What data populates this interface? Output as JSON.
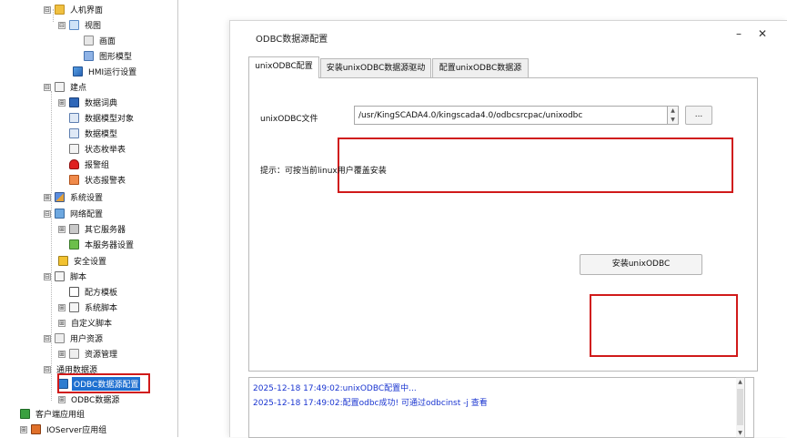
{
  "tree": {
    "items": [
      {
        "label": "人机界面",
        "icon": "folder-icon",
        "toggle": "⊟"
      },
      {
        "label": "视图",
        "icon": "view-icon",
        "toggle": "⊟"
      },
      {
        "label": "画面",
        "icon": "screen-icon",
        "toggle": ""
      },
      {
        "label": "图形模型",
        "icon": "graphic-model-icon",
        "toggle": ""
      },
      {
        "label": "HMI运行设置",
        "icon": "hmi-run-icon",
        "toggle": ""
      },
      {
        "label": "建点",
        "icon": "list-icon",
        "toggle": "⊟"
      },
      {
        "label": "数据词典",
        "icon": "book-icon",
        "toggle": "⊞"
      },
      {
        "label": "数据模型对象",
        "icon": "grid-icon",
        "toggle": ""
      },
      {
        "label": "数据模型",
        "icon": "grid-icon",
        "toggle": ""
      },
      {
        "label": "状态枚举表",
        "icon": "list-icon",
        "toggle": ""
      },
      {
        "label": "报警组",
        "icon": "alarm-icon",
        "toggle": ""
      },
      {
        "label": "状态报警表",
        "icon": "alarm-table-icon",
        "toggle": ""
      },
      {
        "label": "系统设置",
        "icon": "system-settings-icon",
        "toggle": "⊞"
      },
      {
        "label": "网络配置",
        "icon": "network-icon",
        "toggle": "⊟"
      },
      {
        "label": "其它服务器",
        "icon": "server-icon",
        "toggle": "⊞"
      },
      {
        "label": "本服务器设置",
        "icon": "local-server-icon",
        "toggle": ""
      },
      {
        "label": "安全设置",
        "icon": "lock-icon",
        "toggle": ""
      },
      {
        "label": "脚本",
        "icon": "script-icon",
        "toggle": "⊟"
      },
      {
        "label": "配方模板",
        "icon": "recipe-icon",
        "toggle": ""
      },
      {
        "label": "系统脚本",
        "icon": "script-icon",
        "toggle": "⊞"
      },
      {
        "label": "自定义脚本",
        "icon": "",
        "toggle": "⊞"
      },
      {
        "label": "用户资源",
        "icon": "resource-icon",
        "toggle": "⊟"
      },
      {
        "label": "资源管理",
        "icon": "resource-icon",
        "toggle": "⊞"
      },
      {
        "label": "通用数据源",
        "icon": "",
        "toggle": "⊟"
      },
      {
        "label": "ODBC数据源配置",
        "icon": "odbc-config-icon",
        "toggle": ""
      },
      {
        "label": "ODBC数据源",
        "icon": "odbc-source-icon",
        "toggle": "⊞"
      },
      {
        "label": "客户端应用组",
        "icon": "client-group-icon",
        "toggle": ""
      },
      {
        "label": "IOServer应用组",
        "icon": "ioserver-group-icon",
        "toggle": "⊞"
      }
    ]
  },
  "dialog": {
    "title": "ODBC数据源配置",
    "minimize_glyph": "–",
    "close_glyph": "✕",
    "tabs": [
      {
        "label": "unixODBC配置",
        "active": true
      },
      {
        "label": "安装unixODBC数据源驱动",
        "active": false
      },
      {
        "label": "配置unixODBC数据源",
        "active": false
      }
    ],
    "file_label": "unixODBC文件",
    "file_value": "/usr/KingSCADA4.0/kingscada4.0/odbcsrcpac/unixodbc",
    "browse_label": "...",
    "hint": "提示：可按当前linux用户覆盖安装",
    "install_button": "安装unixODBC",
    "log_lines": [
      "2025-12-18 17:49:02:unixODBC配置中...",
      "2025-12-18 17:49:02:配置odbc成功! 可通过odbcinst -j 查看"
    ]
  },
  "colors": {
    "highlight_red": "#d01a1a",
    "selection_blue": "#1e6fd0",
    "log_text_blue": "#1a35d0"
  }
}
